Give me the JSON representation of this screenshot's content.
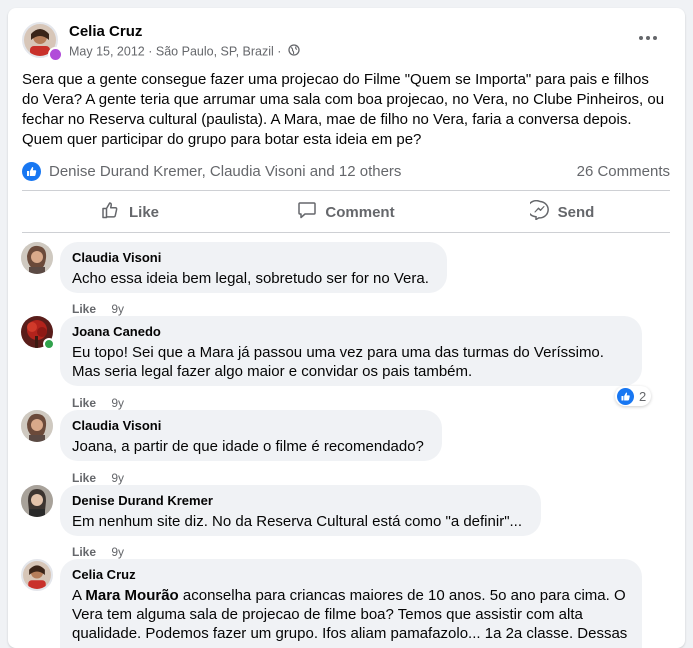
{
  "post": {
    "author": "Celia Cruz",
    "date": "May 15, 2012",
    "location": "São Paulo, SP, Brazil",
    "separator": "·",
    "privacy_icon": "globe-icon",
    "text": "Sera que a gente consegue fazer uma projecao do Filme \"Quem se Importa\" para pais e filhos do Vera? A gente teria que arrumar uma sala com boa projecao, no Vera, no Clube Pinheiros, ou fechar no Reserva cultural (paulista). A Mara, mae de filho no Vera, faria a conversa depois. Quem quer participar do grupo para botar esta ideia em pe?",
    "reactors": "Denise Durand Kremer, Claudia Visoni and 12 others",
    "comments_count": "26 Comments"
  },
  "actions": {
    "like": "Like",
    "comment": "Comment",
    "send": "Send"
  },
  "comments": [
    {
      "name": "Claudia Visoni",
      "text": "Acho essa ideia bem legal, sobretudo ser for no Vera.",
      "like": "Like",
      "time": "9y"
    },
    {
      "name": "Joana Canedo",
      "text": "Eu topo! Sei que a Mara já passou uma vez para uma das turmas do Veríssimo. Mas seria legal fazer algo maior e convidar os pais também.",
      "like": "Like",
      "time": "9y",
      "reactions": "2"
    },
    {
      "name": "Claudia Visoni",
      "text": "Joana, a partir de que idade o filme é recomendado?",
      "like": "Like",
      "time": "9y"
    },
    {
      "name": "Denise Durand Kremer",
      "text": "Em nenhum site diz. No da Reserva Cultural está como \"a definir\"...",
      "like": "Like",
      "time": "9y"
    },
    {
      "name": "Celia Cruz",
      "mention": "Mara Mourão",
      "text_prefix": "A",
      "text": "aconselha para criancas maiores de 10 anos. 5o ano para cima. O Vera tem alguma sala de projecao de filme boa? Temos que assistir com alta qualidade. Podemos fazer um grupo. Ifos aliam pamafazolo... 1a 2a classe. Dessas"
    }
  ],
  "colors": {
    "accent": "#1877f2",
    "muted": "#65676b",
    "bubble": "#f0f2f5",
    "online": "#31a24c"
  }
}
